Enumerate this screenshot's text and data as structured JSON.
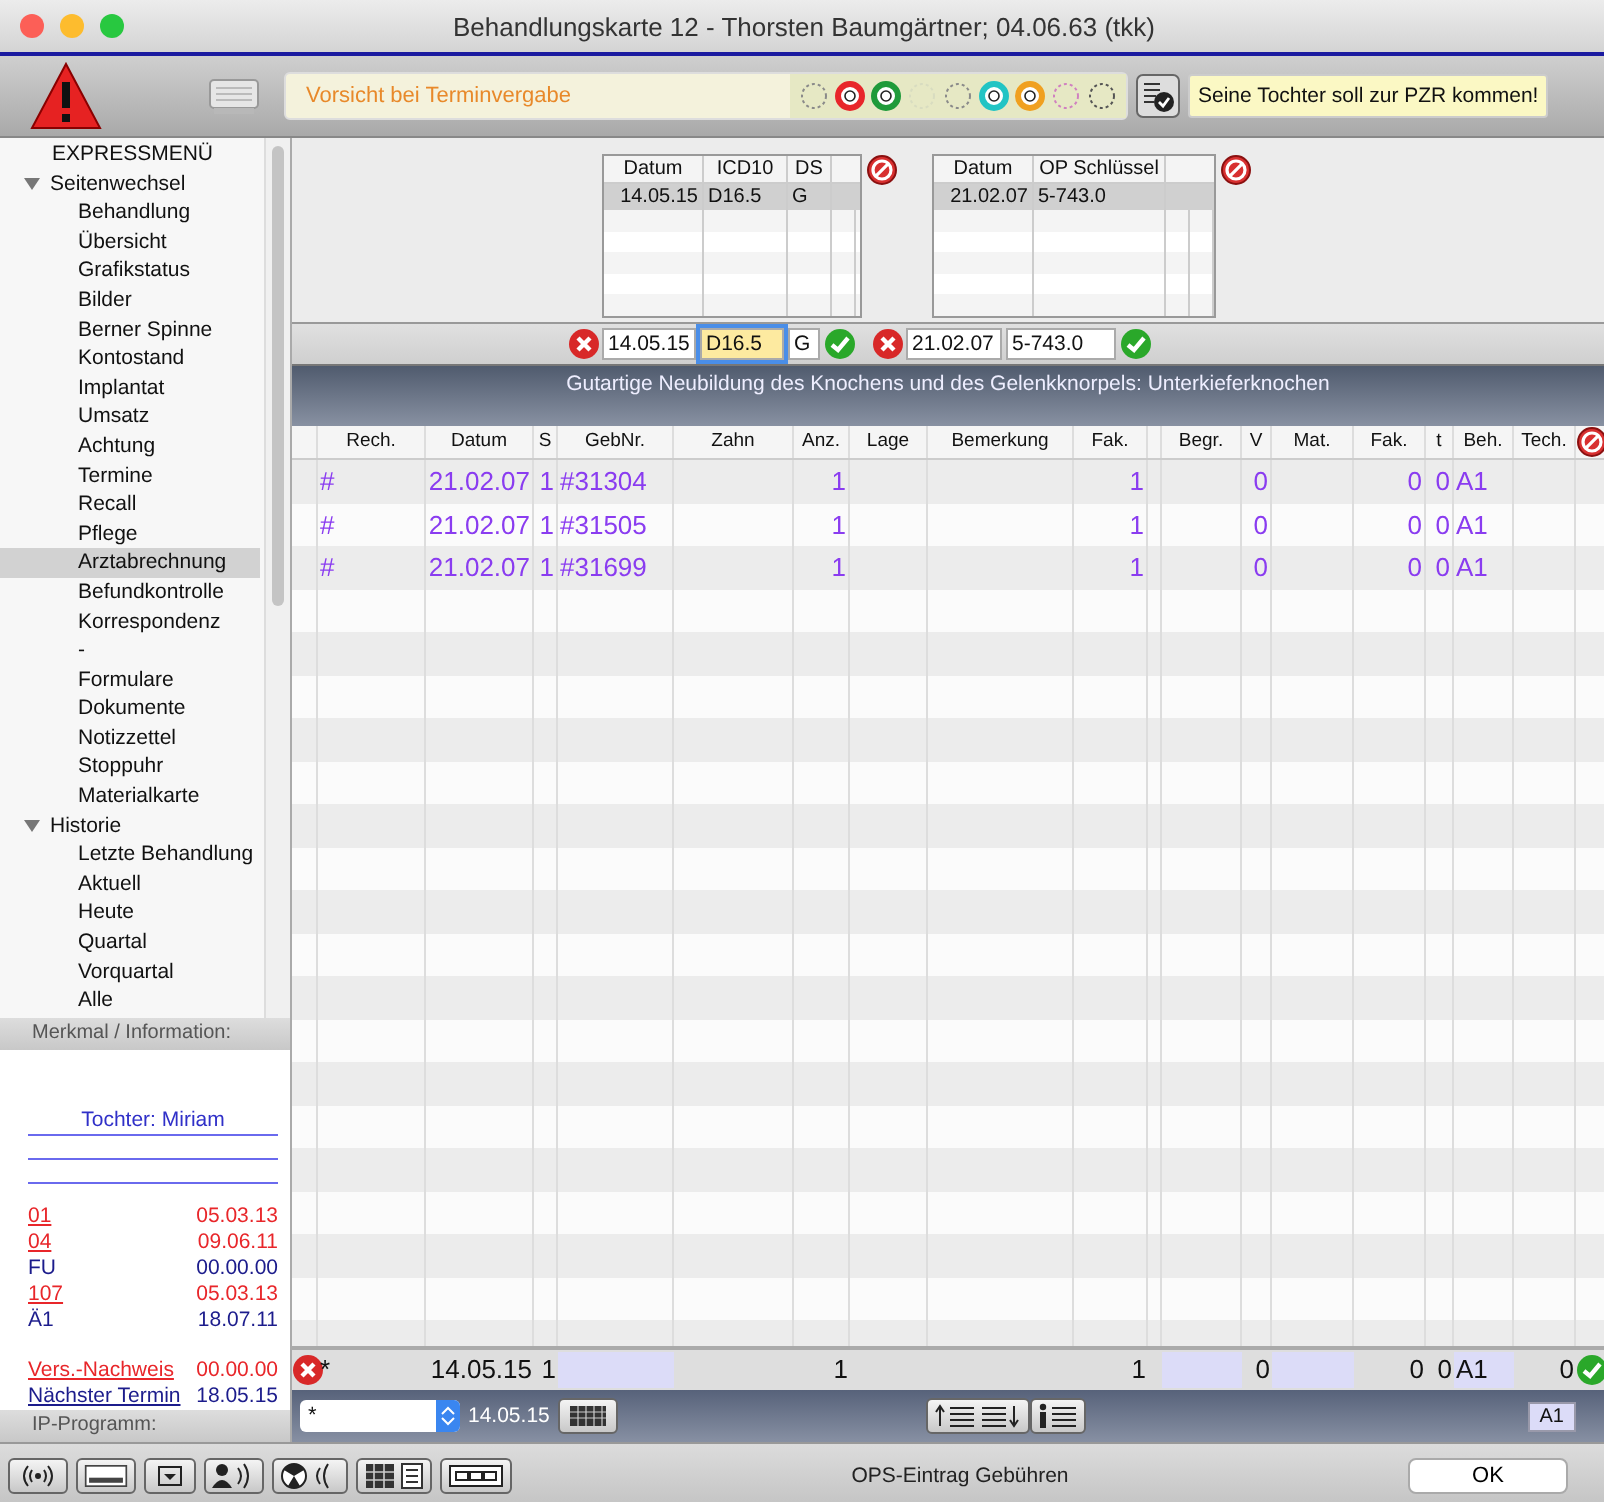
{
  "window": {
    "title": "Behandlungskarte 12 - Thorsten Baumgärtner; 04.06.63 (tkk)"
  },
  "toolbar": {
    "warning": "Vorsicht bei Terminvergabe",
    "dots": [
      {
        "kind": "dotted",
        "color": "#8a8a8a"
      },
      {
        "kind": "ring",
        "color": "#e8262a"
      },
      {
        "kind": "ring",
        "color": "#1f9a3a"
      },
      {
        "kind": "dotted",
        "color": "#d8dcc0"
      },
      {
        "kind": "dotted",
        "color": "#8a8a8a"
      },
      {
        "kind": "ring",
        "color": "#22c4c4"
      },
      {
        "kind": "ring",
        "color": "#f0a020"
      },
      {
        "kind": "dotted",
        "color": "#d080c0"
      },
      {
        "kind": "dotted",
        "color": "#555555"
      }
    ],
    "note": "Seine Tochter soll zur PZR kommen!"
  },
  "sidebar": {
    "title": "EXPRESSMENÜ",
    "groups": [
      {
        "label": "Seitenwechsel",
        "expanded": true,
        "children": [
          {
            "label": "Behandlung",
            "selected": false
          },
          {
            "label": "Übersicht",
            "selected": false
          },
          {
            "label": "Grafikstatus",
            "selected": false
          },
          {
            "label": "Bilder",
            "selected": false
          },
          {
            "label": "Berner Spinne",
            "selected": false
          },
          {
            "label": "Kontostand",
            "selected": false
          },
          {
            "label": "Implantat",
            "selected": false
          },
          {
            "label": "Umsatz",
            "selected": false
          },
          {
            "label": "Achtung",
            "selected": false
          },
          {
            "label": "Termine",
            "selected": false
          },
          {
            "label": "Recall",
            "selected": false
          },
          {
            "label": "Pflege",
            "selected": false
          },
          {
            "label": "Arztabrechnung",
            "selected": true
          },
          {
            "label": "Befundkontrolle",
            "selected": false
          },
          {
            "label": "Korrespondenz",
            "selected": false
          },
          {
            "label": "-",
            "selected": false
          },
          {
            "label": "Formulare",
            "selected": false
          },
          {
            "label": "Dokumente",
            "selected": false
          },
          {
            "label": "Notizzettel",
            "selected": false
          },
          {
            "label": "Stoppuhr",
            "selected": false
          },
          {
            "label": "Materialkarte",
            "selected": false
          }
        ]
      },
      {
        "label": "Historie",
        "expanded": true,
        "children": [
          {
            "label": "Letzte Behandlung",
            "selected": false
          },
          {
            "label": "Aktuell",
            "selected": false
          },
          {
            "label": "Heute",
            "selected": false
          },
          {
            "label": "Quartal",
            "selected": false
          },
          {
            "label": "Vorquartal",
            "selected": false
          },
          {
            "label": "Alle",
            "selected": false
          }
        ]
      }
    ]
  },
  "info": {
    "title": "Merkmal / Information:",
    "lines": [
      "Tochter: Miriam"
    ],
    "entries": [
      {
        "label": "01",
        "date": "05.03.13",
        "color": "#e8262a",
        "link": true
      },
      {
        "label": "04",
        "date": "09.06.11",
        "color": "#e8262a",
        "link": true
      },
      {
        "label": "FU",
        "date": "00.00.00",
        "color": "#1c1c8c",
        "link": false
      },
      {
        "label": "107",
        "date": "05.03.13",
        "color": "#e8262a",
        "link": true
      },
      {
        "label": "Ä1",
        "date": "18.07.11",
        "color": "#1c1c8c",
        "link": false
      }
    ],
    "footer_entries": [
      {
        "label": "Vers.-Nachweis",
        "date": "00.00.00",
        "color": "#e8262a",
        "link": true
      },
      {
        "label": "Nächster Termin",
        "date": "18.05.15",
        "color": "#1c1c8c",
        "link": true
      }
    ],
    "program_label": "IP-Programm:"
  },
  "diagnoses": {
    "columns": [
      "Datum",
      "ICD10",
      "DS"
    ],
    "rows": [
      {
        "cells": [
          "14.05.15",
          "D16.5",
          "G"
        ],
        "selected": true
      }
    ],
    "fields": [
      {
        "value": "14.05.15",
        "focused": false
      },
      {
        "value": "D16.5",
        "focused": true
      },
      {
        "value": "G",
        "focused": false
      }
    ]
  },
  "operations": {
    "columns": [
      "Datum",
      "OP Schlüssel"
    ],
    "rows": [
      {
        "cells": [
          "21.02.07",
          "5-743.0"
        ],
        "selected": true
      }
    ],
    "fields": [
      {
        "value": "21.02.07",
        "focused": false
      },
      {
        "value": "5-743.0",
        "focused": false
      }
    ]
  },
  "description": "Gutartige Neubildung des Knochens und des Gelenkknorpels: Unterkieferknochen",
  "table": {
    "columns": [
      {
        "kind": "data",
        "label": "Rech."
      },
      {
        "kind": "data",
        "label": "Datum"
      },
      {
        "kind": "data",
        "label": "S"
      },
      {
        "kind": "data",
        "label": "GebNr."
      },
      {
        "kind": "data",
        "label": "Zahn"
      },
      {
        "kind": "data",
        "label": "Anz."
      },
      {
        "kind": "data",
        "label": "Lage"
      },
      {
        "kind": "data",
        "label": "Bemerkung"
      },
      {
        "kind": "data",
        "label": "Fak."
      },
      {
        "kind": "spacer"
      },
      {
        "kind": "data",
        "label": "Begr."
      },
      {
        "kind": "data",
        "label": "V"
      },
      {
        "kind": "data",
        "label": "Mat."
      },
      {
        "kind": "data",
        "label": "Fak."
      },
      {
        "kind": "data",
        "label": "t"
      },
      {
        "kind": "data",
        "label": "Beh."
      },
      {
        "kind": "data",
        "label": "Tech."
      }
    ],
    "rows": [
      {
        "rech": "#",
        "datum": "21.02.07",
        "s": "1",
        "gebnr": "#31304",
        "anz": "1",
        "fak": "1",
        "v": "0",
        "fak_2": "0",
        "t": "0",
        "beh": "A1"
      },
      {
        "rech": "#",
        "datum": "21.02.07",
        "s": "1",
        "gebnr": "#31505",
        "anz": "1",
        "fak": "1",
        "v": "0",
        "fak_2": "0",
        "t": "0",
        "beh": "A1"
      },
      {
        "rech": "#",
        "datum": "21.02.07",
        "s": "1",
        "gebnr": "#31699",
        "anz": "1",
        "fak": "1",
        "v": "0",
        "fak_2": "0",
        "t": "0",
        "beh": "A1"
      }
    ],
    "entry_row": [
      {
        "kind": "text",
        "value": "*"
      },
      {
        "kind": "text",
        "value": "14.05.15"
      },
      {
        "kind": "text",
        "value": "1"
      },
      {
        "kind": "input"
      },
      {
        "kind": "empty"
      },
      {
        "kind": "text",
        "value": "1"
      },
      {
        "kind": "empty"
      },
      {
        "kind": "empty"
      },
      {
        "kind": "text",
        "value": "1"
      },
      {
        "kind": "empty"
      },
      {
        "kind": "input"
      },
      {
        "kind": "text",
        "value": "0"
      },
      {
        "kind": "input"
      },
      {
        "kind": "text",
        "value": "0"
      },
      {
        "kind": "text",
        "value": "0"
      },
      {
        "kind": "input",
        "value": "A1"
      },
      {
        "kind": "text",
        "value": "0"
      }
    ]
  },
  "bottom_toolbar": {
    "select": "*",
    "date": "14.05.15",
    "badge": "A1"
  },
  "status": "OPS-Eintrag Gebühren",
  "ok_button": "OK"
}
